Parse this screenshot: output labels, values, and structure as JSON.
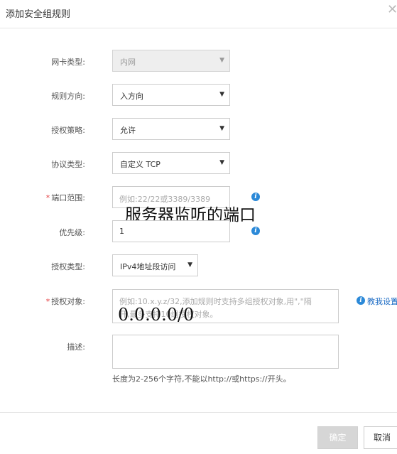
{
  "dialog": {
    "title": "添加安全组规则"
  },
  "form": {
    "nic_type": {
      "label": "网卡类型:",
      "value": "内网"
    },
    "direction": {
      "label": "规则方向:",
      "value": "入方向"
    },
    "policy": {
      "label": "授权策略:",
      "value": "允许"
    },
    "protocol": {
      "label": "协议类型:",
      "value": "自定义 TCP"
    },
    "port_range": {
      "label": "端口范围:",
      "placeholder": "例如:22/22或3389/3389"
    },
    "priority": {
      "label": "优先级:",
      "value": "1"
    },
    "auth_type": {
      "label": "授权类型:",
      "value": "IPv4地址段访问"
    },
    "auth_object": {
      "label": "授权对象:",
      "placeholder_line1": "例如:10.x.y.z/32,添加规则时支持多组授权对象,用\",\"隔",
      "placeholder_line2": "开,最多支持10组授权对象。",
      "help_link": "教我设置"
    },
    "description": {
      "label": "描述:",
      "hint": "长度为2-256个字符,不能以http://或https://开头。"
    }
  },
  "annotations": {
    "port_note": "服务器监听的端口",
    "ip_note": "0.0.0.0/0"
  },
  "buttons": {
    "ok": "确定",
    "cancel": "取消"
  },
  "icons": {
    "close": "close-icon",
    "info": "info-icon",
    "dropdown": "caret-down-icon"
  },
  "colors": {
    "info_blue": "#2b89d8",
    "required_red": "#e4393c",
    "link_blue": "#1b6bc4"
  }
}
